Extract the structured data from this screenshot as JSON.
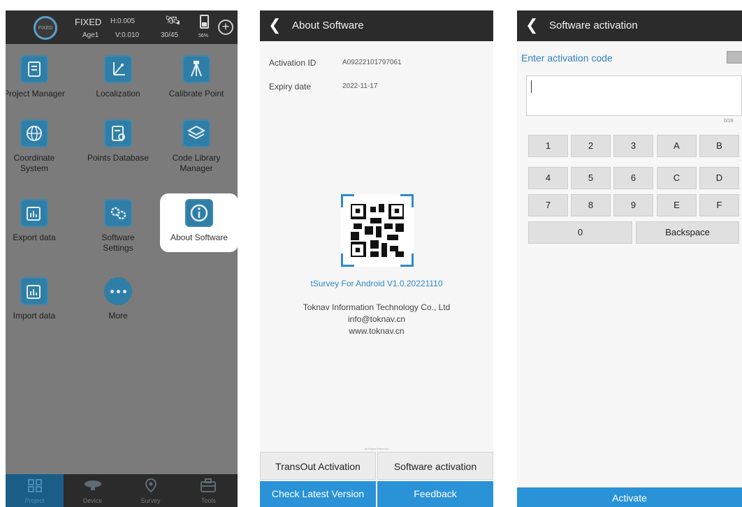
{
  "home": {
    "status": {
      "ring_label": "FIXED",
      "fix": "FIXED",
      "h_precision": "H:0.005",
      "age": "Age1",
      "v_precision": "V:0.010",
      "satellites": "30/45",
      "battery": "56%"
    },
    "grid": [
      {
        "label": "Project Manager",
        "icon": "project-icon"
      },
      {
        "label": "Localization",
        "icon": "localization-icon"
      },
      {
        "label": "Calibrate Point",
        "icon": "calibrate-icon"
      },
      {
        "label": "Coordinate System",
        "icon": "globe-icon"
      },
      {
        "label": "Points Database",
        "icon": "database-icon"
      },
      {
        "label": "Code Library Manager",
        "icon": "layers-icon"
      },
      {
        "label": "Export data",
        "icon": "export-icon"
      },
      {
        "label": "Software Settings",
        "icon": "settings-icon"
      },
      {
        "label": "About Software",
        "icon": "info-icon"
      },
      {
        "label": "Import data",
        "icon": "import-icon"
      },
      {
        "label": "More",
        "icon": "more-icon"
      }
    ],
    "tabs": [
      {
        "label": "Project",
        "icon": "project-tab-icon"
      },
      {
        "label": "Device",
        "icon": "device-tab-icon"
      },
      {
        "label": "Survey",
        "icon": "survey-tab-icon"
      },
      {
        "label": "Tools",
        "icon": "tools-tab-icon"
      }
    ]
  },
  "about": {
    "title": "About Software",
    "activation_id_label": "Activation ID",
    "activation_id": "A09222101797061",
    "expiry_label": "Expiry date",
    "expiry": "2022-11-17",
    "version": "tSurvey For Android V1.0.20221110",
    "company": "Toknav Information Technology Co., Ltd",
    "email": "info@toknav.cn",
    "website": "www.toknav.cn",
    "rights": "All Rights Reserved",
    "btn_transout": "TransOut Activation",
    "btn_software_activation": "Software activation",
    "btn_check_version": "Check Latest Version",
    "btn_feedback": "Feedback",
    "accent": "#2a92d6"
  },
  "activation": {
    "title": "Software activation",
    "prompt": "Enter activation code",
    "counter": "0/28",
    "keys": [
      "1",
      "2",
      "3",
      "A",
      "B",
      "4",
      "5",
      "6",
      "C",
      "D",
      "7",
      "8",
      "9",
      "E",
      "F"
    ],
    "key_zero": "0",
    "key_backspace": "Backspace",
    "activate": "Activate"
  }
}
